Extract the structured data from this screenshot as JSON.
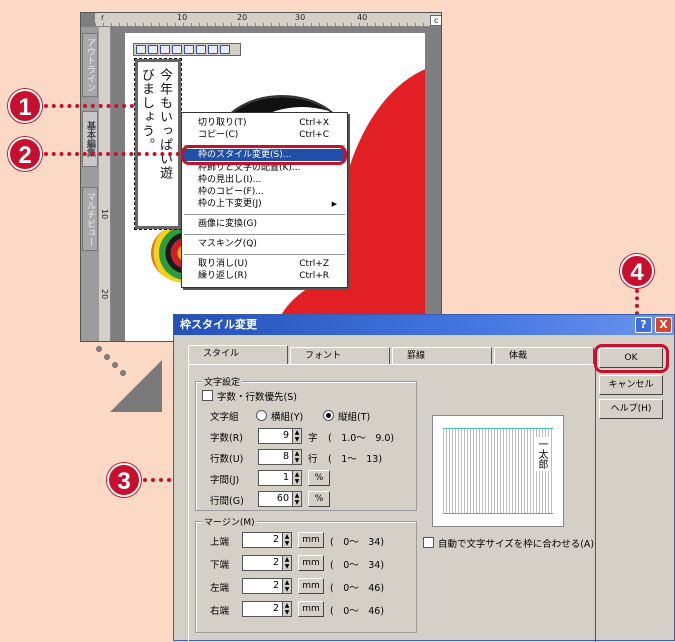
{
  "editor": {
    "ruler_top": [
      "r",
      "10",
      "20",
      "30",
      "40",
      "c"
    ],
    "ruler_left": [
      "10",
      "20"
    ],
    "side_tabs": [
      "アウトライン",
      "基本編集",
      "マルチビュー"
    ],
    "vertical_text": [
      "今年もいっぱい遊",
      "びましょう。"
    ]
  },
  "context_menu": {
    "items": [
      {
        "label": "切り取り(T)",
        "shortcut": "Ctrl+X"
      },
      {
        "label": "コピー(C)",
        "shortcut": "Ctrl+C"
      },
      {
        "label": "枠のスタイル変更(S)...",
        "shortcut": ""
      },
      {
        "label": "枠飾りと文字の配置(K)...",
        "shortcut": ""
      },
      {
        "label": "枠の見出し(I)...",
        "shortcut": ""
      },
      {
        "label": "枠のコピー(F)...",
        "shortcut": ""
      },
      {
        "label": "枠の上下変更(J)",
        "shortcut": ""
      },
      {
        "label": "画像に変換(G)",
        "shortcut": ""
      },
      {
        "label": "マスキング(Q)",
        "shortcut": ""
      },
      {
        "label": "取り消し(U)",
        "shortcut": "Ctrl+Z"
      },
      {
        "label": "繰り返し(R)",
        "shortcut": "Ctrl+R"
      }
    ]
  },
  "callouts": {
    "one": "1",
    "two": "2",
    "three": "3",
    "four": "4"
  },
  "dialog": {
    "title": "枠スタイル変更",
    "help_glyph": "?",
    "close_glyph": "X",
    "tabs": [
      "スタイル",
      "フォント",
      "罫線",
      "体裁"
    ],
    "char_settings": {
      "title": "文字設定",
      "priority_checkbox": "字数・行数優先(S)",
      "direction_label": "文字組",
      "horizontal_radio": "横組(Y)",
      "vertical_radio": "縦組(T)",
      "rows": [
        {
          "label": "字数(R)",
          "value": "9",
          "unit": "字",
          "range": "(　1.0〜　9.0)"
        },
        {
          "label": "行数(U)",
          "value": "8",
          "unit": "行",
          "range": "(　1〜　13)"
        },
        {
          "label": "字間(J)",
          "value": "1",
          "unit": "%",
          "range": ""
        },
        {
          "label": "行間(G)",
          "value": "60",
          "unit": "%",
          "range": ""
        }
      ]
    },
    "margin": {
      "title": "マージン(M)",
      "rows": [
        {
          "label": "上端",
          "value": "2",
          "unit": "mm",
          "range": "(　0〜　34)"
        },
        {
          "label": "下端",
          "value": "2",
          "unit": "mm",
          "range": "(　0〜　34)"
        },
        {
          "label": "左端",
          "value": "2",
          "unit": "mm",
          "range": "(　0〜　46)"
        },
        {
          "label": "右端",
          "value": "2",
          "unit": "mm",
          "range": "(　0〜　46)"
        }
      ]
    },
    "autofit_checkbox": "自動で文字サイズを枠に合わせる(A)",
    "preview_text": "一太郎",
    "ok_button": "OK",
    "cancel_button": "キャンセル",
    "help_button": "ヘルプ(H)"
  },
  "colors": {
    "accent": "#c8102e",
    "title_bar": "#2451b9",
    "highlight": "#1f4fa8"
  }
}
